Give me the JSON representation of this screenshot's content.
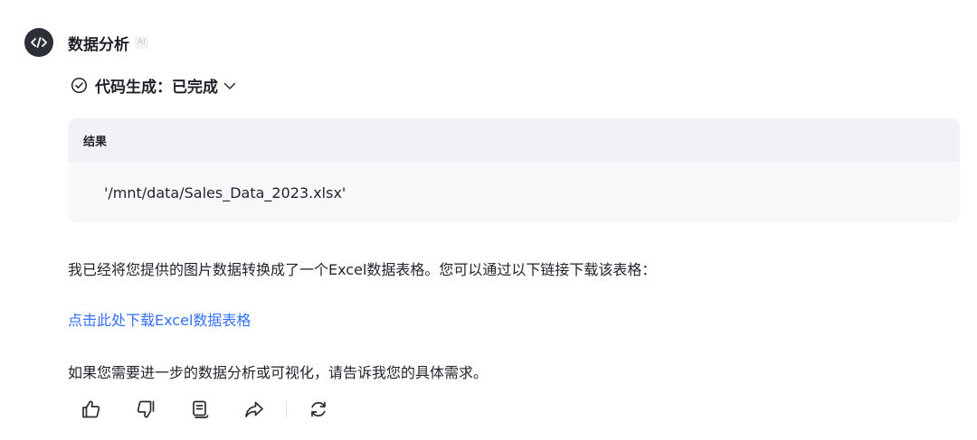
{
  "assistant": {
    "name": "数据分析",
    "badge": "AI",
    "avatar_icon": "code-icon"
  },
  "status": {
    "label": "代码生成：已完成",
    "icon": "check-circle-icon",
    "chevron_icon": "chevron-down-icon"
  },
  "result": {
    "title": "结果",
    "value": "'/mnt/data/Sales_Data_2023.xlsx'"
  },
  "message": {
    "paragraph1": "我已经将您提供的图片数据转换成了一个Excel数据表格。您可以通过以下链接下载该表格：",
    "download_link": "点击此处下载Excel数据表格",
    "paragraph2": "如果您需要进一步的数据分析或可视化，请告诉我您的具体需求。"
  },
  "actions": [
    "thumbs-up-icon",
    "thumbs-down-icon",
    "copy-icon",
    "share-icon",
    "regenerate-icon"
  ],
  "colors": {
    "link": "#3370ff",
    "text": "#1f2329",
    "card_bg": "#f7f8fa",
    "avatar_bg": "#2b2f36"
  }
}
